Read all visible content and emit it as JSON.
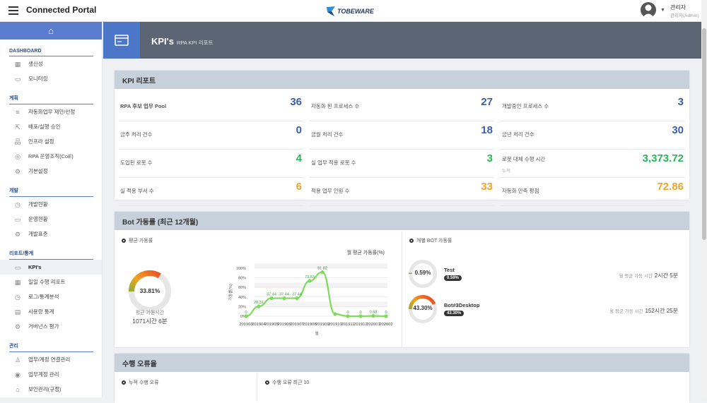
{
  "header": {
    "title": "Connected Portal",
    "logo_text": "TOBEWARE",
    "user_name": "관리자",
    "user_role": "관리자(Admin)"
  },
  "sidebar": {
    "sections": [
      {
        "title": "DASHBOARD",
        "items": [
          {
            "label": "생산성",
            "icon": "chart-icon"
          },
          {
            "label": "모니터링",
            "icon": "monitor-icon"
          }
        ]
      },
      {
        "title": "계획",
        "items": [
          {
            "label": "자동화업무 제안/선정",
            "icon": "list-icon"
          },
          {
            "label": "배포/실행 승인",
            "icon": "deploy-icon"
          },
          {
            "label": "인프라 설정",
            "icon": "network-icon"
          },
          {
            "label": "RPA 운영조직(CoE)",
            "icon": "org-icon"
          },
          {
            "label": "기본설정",
            "icon": "gear-icon"
          }
        ]
      },
      {
        "title": "개발",
        "items": [
          {
            "label": "개발현황",
            "icon": "clock-icon"
          },
          {
            "label": "운영현황",
            "icon": "screen-icon"
          },
          {
            "label": "개발표준",
            "icon": "gear-icon"
          }
        ]
      },
      {
        "title": "리포트/통계",
        "items": [
          {
            "label": "KPI's",
            "icon": "card-icon",
            "active": true
          },
          {
            "label": "일일 수행 리포트",
            "icon": "chart-icon"
          },
          {
            "label": "로그/통계분석",
            "icon": "clock-icon"
          },
          {
            "label": "사용량 통계",
            "icon": "doc-icon"
          },
          {
            "label": "거버넌스 평가",
            "icon": "gear-icon"
          }
        ]
      },
      {
        "title": "관리",
        "items": [
          {
            "label": "업무/계정 연결관리",
            "icon": "user-icon"
          },
          {
            "label": "업무계정 관리",
            "icon": "id-icon"
          },
          {
            "label": "보안관리(규정)",
            "icon": "lock-icon"
          }
        ]
      }
    ]
  },
  "banner": {
    "title": "KPI's",
    "subtitle": "RPA KPI 리포트"
  },
  "kpi": {
    "title": "KPI 리포트",
    "rows": [
      [
        {
          "label": "RPA 후보 업무 Pool",
          "value": "36",
          "color": "#3a5fa8"
        },
        {
          "label": "자동화 된 프로세스 수",
          "value": "27",
          "color": "#3a5fa8"
        },
        {
          "label": "개발중인 프로세스 수",
          "value": "3",
          "color": "#3a5fa8"
        }
      ],
      [
        {
          "label": "금주 처리 건수",
          "value": "0",
          "color": "#3a5fa8"
        },
        {
          "label": "금월 처리 건수",
          "value": "18",
          "color": "#3a5fa8"
        },
        {
          "label": "금년 처리 건수",
          "value": "30",
          "color": "#3a5fa8"
        }
      ],
      [
        {
          "label": "도입된 로봇 수",
          "value": "4",
          "color": "#2bb55a"
        },
        {
          "label": "실 업무 적용 로봇 수",
          "value": "3",
          "color": "#2bb55a"
        },
        {
          "label": "로봇 대체 수행 시간",
          "note": "누적",
          "value": "3,373.72",
          "color": "#2bb55a"
        }
      ],
      [
        {
          "label": "실 적용 부서 수",
          "value": "6",
          "color": "#f0a52a"
        },
        {
          "label": "적용 업무 인원 수",
          "value": "33",
          "color": "#f0a52a"
        },
        {
          "label": "자동화 만족 평점",
          "value": "72.86",
          "color": "#f0a52a"
        }
      ]
    ]
  },
  "bot": {
    "title": "Bot 가동률 (최근 12개월)",
    "avg_title": "평균 가동률",
    "avg_value": 33.81,
    "avg_label": "33.81%",
    "avg_time_label": "평균 가동시간",
    "avg_time_value": "1071시간 6분",
    "bot_title": "개별 BOT 가동률",
    "bots": [
      {
        "name": "Test",
        "value": 0.59,
        "label": "0.59%",
        "time_label": "월 평균 가동 시간",
        "time": "2시간 5분"
      },
      {
        "name": "Bot#3Desktop",
        "value": 43.3,
        "label": "43.30%",
        "time_label": "월 평균 가동 시간",
        "time": "152시간 25분"
      }
    ]
  },
  "chart_data": {
    "type": "line",
    "title": "월 평균 가동률(%)",
    "xlabel": "월",
    "ylabel": "가동률(%)",
    "categories": [
      "201903",
      "201904",
      "201905",
      "201906",
      "201907",
      "201908",
      "201909",
      "201910",
      "201911",
      "201912",
      "202001",
      "202002"
    ],
    "values": [
      0,
      20.31,
      37.44,
      37.44,
      37.44,
      73.53,
      91.82,
      4.6,
      0,
      0,
      0.58,
      0
    ],
    "data_labels": [
      "0",
      "20.31",
      "37.44",
      "37.44",
      "37.44",
      "73.53",
      "91.82",
      "",
      "0",
      "0",
      "0.58",
      "0"
    ],
    "ylim": [
      0,
      100
    ],
    "yticks": [
      "0%",
      "20%",
      "40%",
      "60%",
      "80%",
      "100%"
    ],
    "color": "#7ddb5a",
    "grid": true
  },
  "errors": {
    "title": "수행 오류율",
    "left_title": "누적 수행 오류",
    "right_title": "수행 오류 최근 10"
  }
}
